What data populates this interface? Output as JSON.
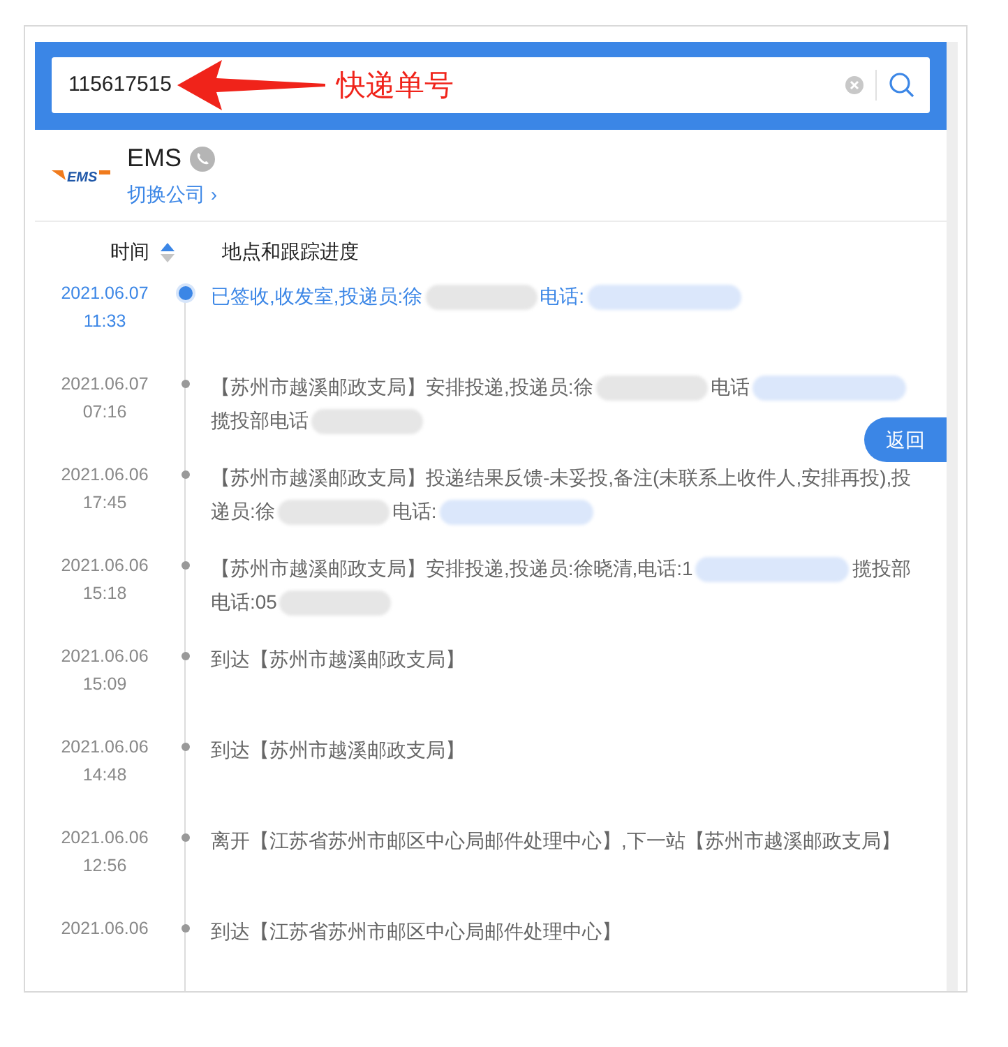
{
  "search": {
    "value": "115617515",
    "annotation": "快递单号"
  },
  "company": {
    "name": "EMS",
    "logo_text": "EMS",
    "switch_link": "切换公司",
    "switch_arrow": "›"
  },
  "columns": {
    "time": "时间",
    "progress": "地点和跟踪进度"
  },
  "back_button": "返回",
  "events": [
    {
      "date": "2021.06.07",
      "time": "11:33",
      "latest": true,
      "parts": [
        {
          "kind": "text",
          "text": "已签收,收发室,投递员:徐"
        },
        {
          "kind": "blur_grey"
        },
        {
          "kind": "text",
          "text": "电话:"
        },
        {
          "kind": "blur_blue"
        }
      ]
    },
    {
      "date": "2021.06.07",
      "time": "07:16",
      "latest": false,
      "parts": [
        {
          "kind": "text",
          "text": "【苏州市越溪邮政支局】安排投递,投递员:徐"
        },
        {
          "kind": "blur_grey"
        },
        {
          "kind": "text",
          "text": "电话"
        },
        {
          "kind": "blur_blue"
        },
        {
          "kind": "text",
          "text": "揽投部电话"
        },
        {
          "kind": "blur_grey"
        }
      ]
    },
    {
      "date": "2021.06.06",
      "time": "17:45",
      "latest": false,
      "parts": [
        {
          "kind": "text",
          "text": "【苏州市越溪邮政支局】投递结果反馈-未妥投,备注(未联系上收件人,安排再投),投递员:徐"
        },
        {
          "kind": "blur_grey"
        },
        {
          "kind": "text",
          "text": "电话:"
        },
        {
          "kind": "blur_blue"
        }
      ]
    },
    {
      "date": "2021.06.06",
      "time": "15:18",
      "latest": false,
      "parts": [
        {
          "kind": "text",
          "text": "【苏州市越溪邮政支局】安排投递,投递员:徐晓清,电话:1"
        },
        {
          "kind": "blur_blue"
        },
        {
          "kind": "text",
          "text": "揽投部电话:05"
        },
        {
          "kind": "blur_grey"
        }
      ]
    },
    {
      "date": "2021.06.06",
      "time": "15:09",
      "latest": false,
      "parts": [
        {
          "kind": "text",
          "text": "到达【苏州市越溪邮政支局】"
        }
      ]
    },
    {
      "date": "2021.06.06",
      "time": "14:48",
      "latest": false,
      "parts": [
        {
          "kind": "text",
          "text": "到达【苏州市越溪邮政支局】"
        }
      ]
    },
    {
      "date": "2021.06.06",
      "time": "12:56",
      "latest": false,
      "parts": [
        {
          "kind": "text",
          "text": "离开【江苏省苏州市邮区中心局邮件处理中心】,下一站【苏州市越溪邮政支局】"
        }
      ]
    },
    {
      "date": "2021.06.06",
      "latest": false,
      "parts": [
        {
          "kind": "text",
          "text": "到达【江苏省苏州市邮区中心局邮件处理中心】"
        }
      ]
    }
  ]
}
